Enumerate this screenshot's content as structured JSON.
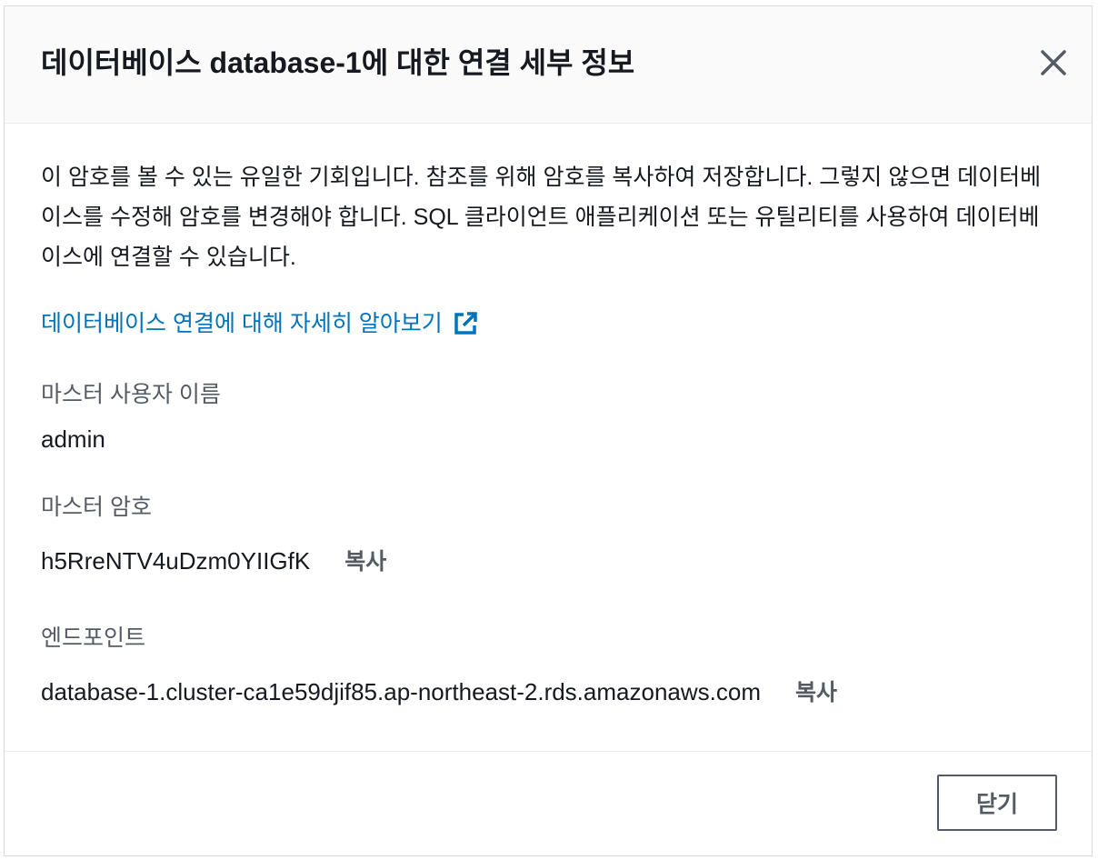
{
  "modal": {
    "title": "데이터베이스 database-1에 대한 연결 세부 정보",
    "close_icon": "close-icon",
    "description": "이 암호를 볼 수 있는 유일한 기회입니다. 참조를 위해 암호를 복사하여 저장합니다. 그렇지 않으면 데이터베이스를 수정해 암호를 변경해야 합니다. SQL 클라이언트 애플리케이션 또는 유틸리티를 사용하여 데이터베이스에 연결할 수 있습니다.",
    "learn_more": {
      "label": "데이터베이스 연결에 대해 자세히 알아보기",
      "icon": "external-link-icon"
    },
    "fields": {
      "master_username": {
        "label": "마스터 사용자 이름",
        "value": "admin"
      },
      "master_password": {
        "label": "마스터 암호",
        "value": "h5RreNTV4uDzm0YIIGfK",
        "copy_label": "복사"
      },
      "endpoint": {
        "label": "엔드포인트",
        "value": "database-1.cluster-ca1e59djif85.ap-northeast-2.rds.amazonaws.com",
        "copy_label": "복사"
      }
    },
    "footer": {
      "close_label": "닫기"
    }
  },
  "colors": {
    "link": "#0073bb",
    "text": "#16191f",
    "label": "#545b64",
    "header_bg": "#fafafa"
  }
}
